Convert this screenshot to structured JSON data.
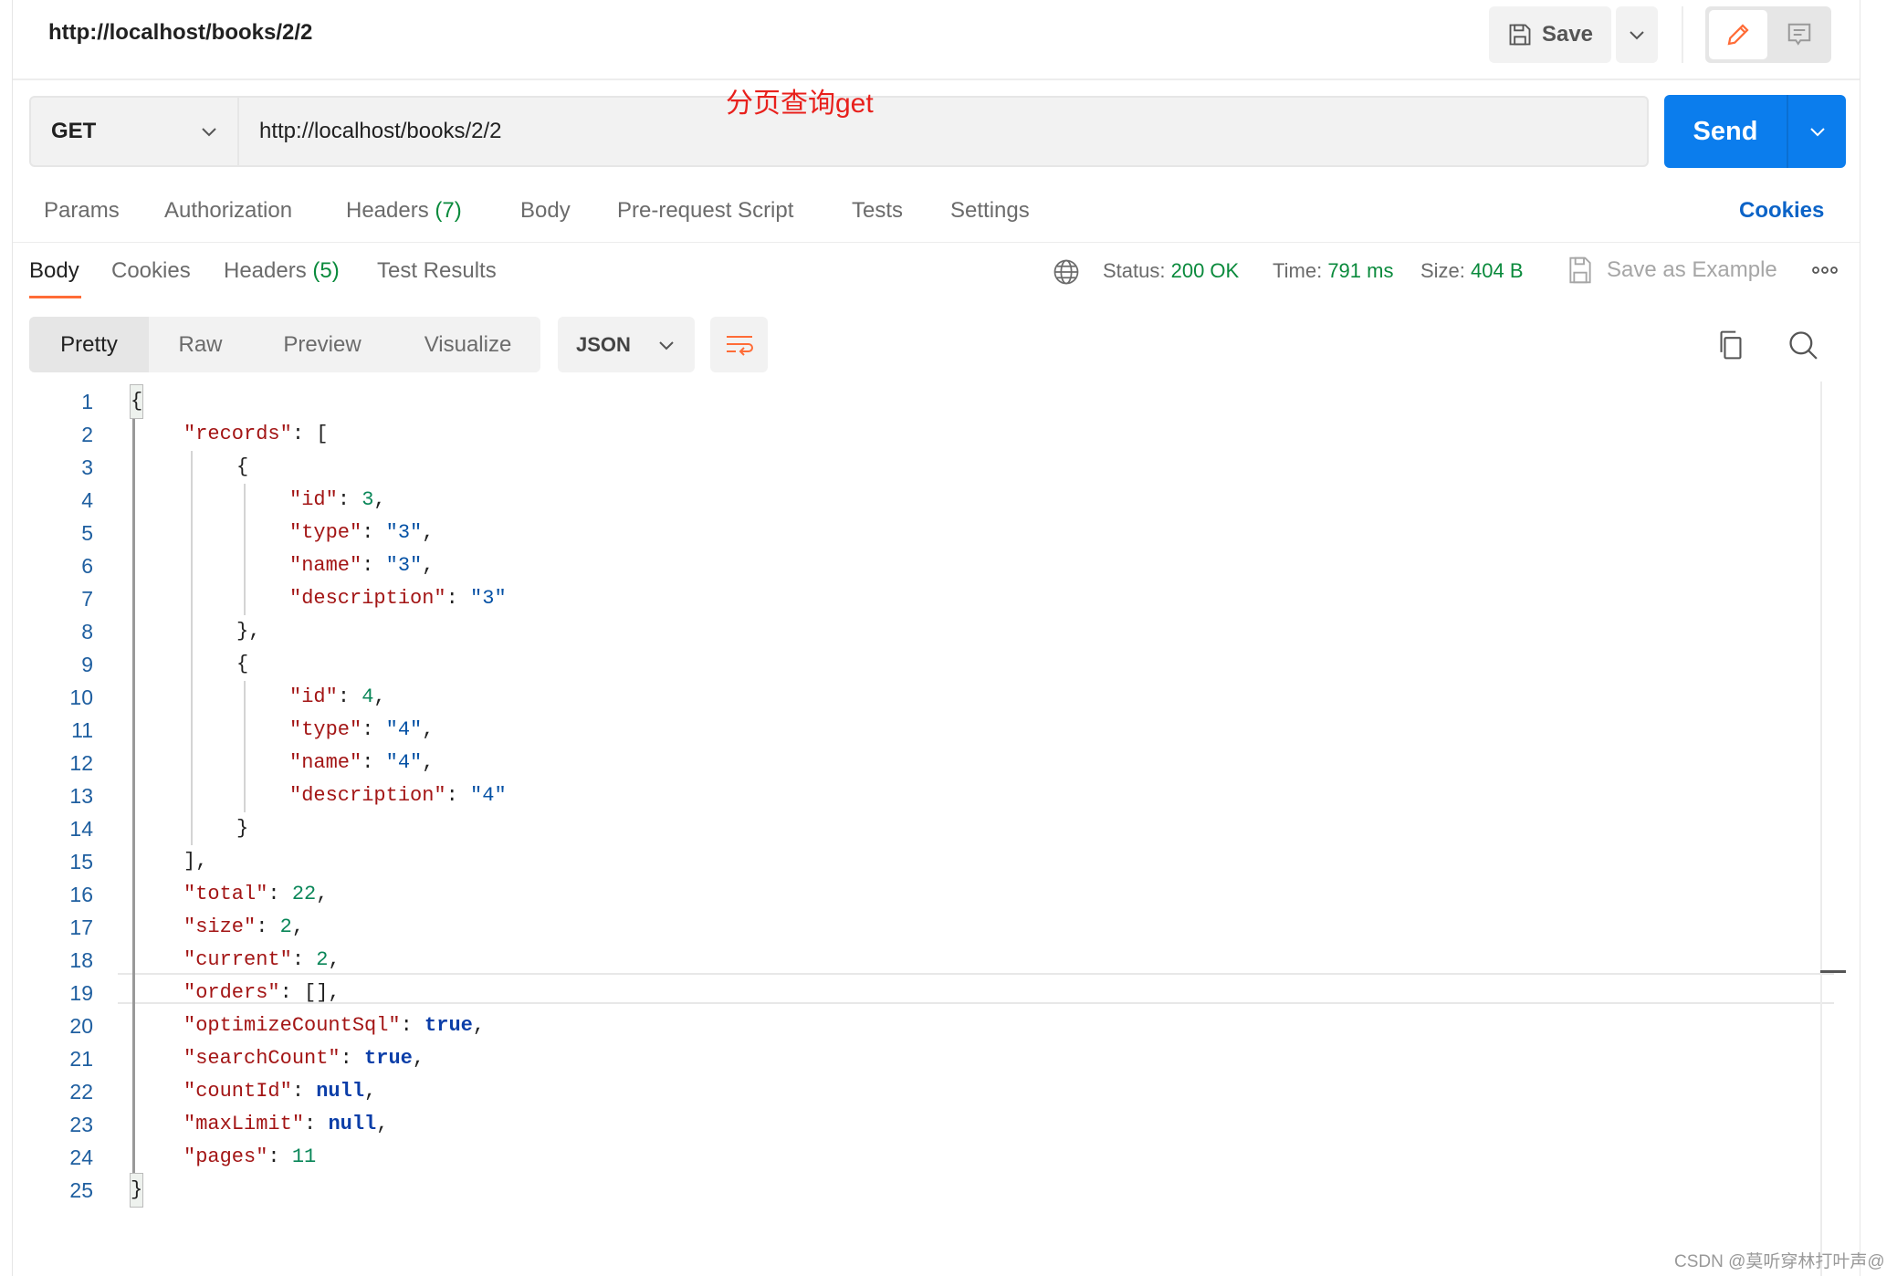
{
  "header": {
    "title": "http://localhost/books/2/2",
    "save_label": "Save"
  },
  "request": {
    "method": "GET",
    "url": "http://localhost/books/2/2",
    "send_label": "Send",
    "annotation": "分页查询get"
  },
  "request_tabs": [
    {
      "label": "Params"
    },
    {
      "label": "Authorization"
    },
    {
      "label": "Headers",
      "count": "(7)"
    },
    {
      "label": "Body"
    },
    {
      "label": "Pre-request Script"
    },
    {
      "label": "Tests"
    },
    {
      "label": "Settings"
    }
  ],
  "cookies_link": "Cookies",
  "response_tabs": [
    {
      "label": "Body",
      "active": true
    },
    {
      "label": "Cookies"
    },
    {
      "label": "Headers",
      "count": "(5)"
    },
    {
      "label": "Test Results"
    }
  ],
  "status": {
    "status_label": "Status:",
    "status_value": "200 OK",
    "time_label": "Time:",
    "time_value": "791 ms",
    "size_label": "Size:",
    "size_value": "404 B",
    "save_example": "Save as Example"
  },
  "view_modes": [
    "Pretty",
    "Raw",
    "Preview",
    "Visualize"
  ],
  "selected_view": "Pretty",
  "format": "JSON",
  "colors": {
    "accent": "#ff6c37",
    "send": "#0b7ded",
    "key": "#a31515",
    "string": "#0451a5",
    "number": "#098658",
    "keyword": "#0b3ea8"
  },
  "code_lines": [
    {
      "d": 0,
      "t": [
        [
          "p",
          "{"
        ]
      ]
    },
    {
      "d": 1,
      "t": [
        [
          "k",
          "\"records\""
        ],
        [
          "p",
          ": ["
        ]
      ]
    },
    {
      "d": 2,
      "t": [
        [
          "p",
          "{"
        ]
      ]
    },
    {
      "d": 3,
      "t": [
        [
          "k",
          "\"id\""
        ],
        [
          "p",
          ": "
        ],
        [
          "n",
          "3"
        ],
        [
          "p",
          ","
        ]
      ]
    },
    {
      "d": 3,
      "t": [
        [
          "k",
          "\"type\""
        ],
        [
          "p",
          ": "
        ],
        [
          "s",
          "\"3\""
        ],
        [
          "p",
          ","
        ]
      ]
    },
    {
      "d": 3,
      "t": [
        [
          "k",
          "\"name\""
        ],
        [
          "p",
          ": "
        ],
        [
          "s",
          "\"3\""
        ],
        [
          "p",
          ","
        ]
      ]
    },
    {
      "d": 3,
      "t": [
        [
          "k",
          "\"description\""
        ],
        [
          "p",
          ": "
        ],
        [
          "s",
          "\"3\""
        ]
      ]
    },
    {
      "d": 2,
      "t": [
        [
          "p",
          "},"
        ]
      ]
    },
    {
      "d": 2,
      "t": [
        [
          "p",
          "{"
        ]
      ]
    },
    {
      "d": 3,
      "t": [
        [
          "k",
          "\"id\""
        ],
        [
          "p",
          ": "
        ],
        [
          "n",
          "4"
        ],
        [
          "p",
          ","
        ]
      ]
    },
    {
      "d": 3,
      "t": [
        [
          "k",
          "\"type\""
        ],
        [
          "p",
          ": "
        ],
        [
          "s",
          "\"4\""
        ],
        [
          "p",
          ","
        ]
      ]
    },
    {
      "d": 3,
      "t": [
        [
          "k",
          "\"name\""
        ],
        [
          "p",
          ": "
        ],
        [
          "s",
          "\"4\""
        ],
        [
          "p",
          ","
        ]
      ]
    },
    {
      "d": 3,
      "t": [
        [
          "k",
          "\"description\""
        ],
        [
          "p",
          ": "
        ],
        [
          "s",
          "\"4\""
        ]
      ]
    },
    {
      "d": 2,
      "t": [
        [
          "p",
          "}"
        ]
      ]
    },
    {
      "d": 1,
      "t": [
        [
          "p",
          "],"
        ]
      ]
    },
    {
      "d": 1,
      "t": [
        [
          "k",
          "\"total\""
        ],
        [
          "p",
          ": "
        ],
        [
          "n",
          "22"
        ],
        [
          "p",
          ","
        ]
      ]
    },
    {
      "d": 1,
      "t": [
        [
          "k",
          "\"size\""
        ],
        [
          "p",
          ": "
        ],
        [
          "n",
          "2"
        ],
        [
          "p",
          ","
        ]
      ]
    },
    {
      "d": 1,
      "t": [
        [
          "k",
          "\"current\""
        ],
        [
          "p",
          ": "
        ],
        [
          "n",
          "2"
        ],
        [
          "p",
          ","
        ]
      ]
    },
    {
      "d": 1,
      "t": [
        [
          "k",
          "\"orders\""
        ],
        [
          "p",
          ": [],"
        ]
      ]
    },
    {
      "d": 1,
      "t": [
        [
          "k",
          "\"optimizeCountSql\""
        ],
        [
          "p",
          ": "
        ],
        [
          "b",
          "true"
        ],
        [
          "p",
          ","
        ]
      ]
    },
    {
      "d": 1,
      "t": [
        [
          "k",
          "\"searchCount\""
        ],
        [
          "p",
          ": "
        ],
        [
          "b",
          "true"
        ],
        [
          "p",
          ","
        ]
      ]
    },
    {
      "d": 1,
      "t": [
        [
          "k",
          "\"countId\""
        ],
        [
          "p",
          ": "
        ],
        [
          "b",
          "null"
        ],
        [
          "p",
          ","
        ]
      ]
    },
    {
      "d": 1,
      "t": [
        [
          "k",
          "\"maxLimit\""
        ],
        [
          "p",
          ": "
        ],
        [
          "b",
          "null"
        ],
        [
          "p",
          ","
        ]
      ]
    },
    {
      "d": 1,
      "t": [
        [
          "k",
          "\"pages\""
        ],
        [
          "p",
          ": "
        ],
        [
          "n",
          "11"
        ]
      ]
    },
    {
      "d": 0,
      "t": [
        [
          "p",
          "}"
        ]
      ]
    }
  ],
  "watermark": "CSDN @莫听穿林打叶声@"
}
